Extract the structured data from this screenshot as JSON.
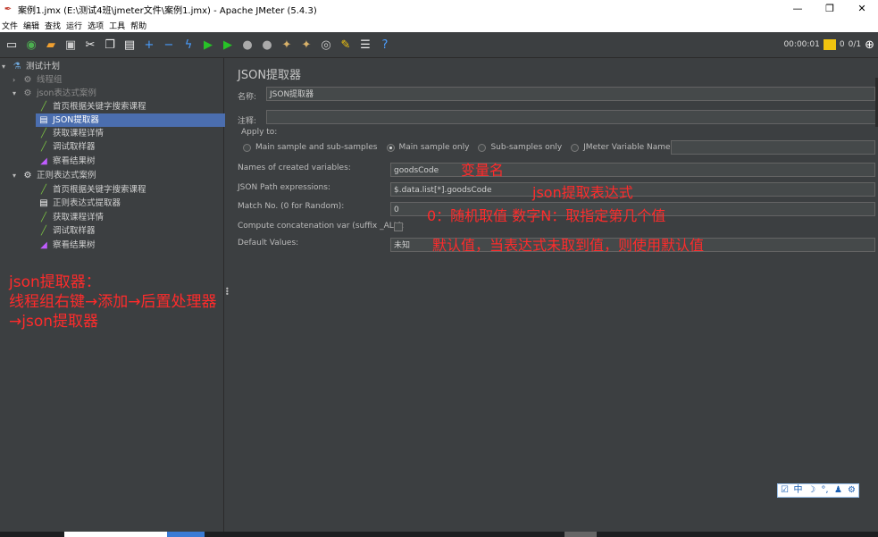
{
  "window": {
    "title": "案例1.jmx (E:\\测试4班\\jmeter文件\\案例1.jmx) - Apache JMeter (5.4.3)",
    "minimize": "—",
    "maximize": "❐",
    "close": "✕"
  },
  "menu": [
    "文件",
    "编辑",
    "查找",
    "运行",
    "选项",
    "工具",
    "帮助"
  ],
  "toolbar_status": {
    "elapsed": "00:00:01",
    "warnings": "0",
    "threads": "0/1"
  },
  "tree": [
    {
      "label": "测试计划",
      "icon": "flask-icon"
    },
    {
      "label": "线程组",
      "icon": "gear-icon"
    },
    {
      "label": "json表达式案例",
      "icon": "gear-icon"
    },
    {
      "label": "首页根据关键字搜索课程",
      "icon": "pipette-icon"
    },
    {
      "label": "JSON提取器",
      "icon": "document-icon"
    },
    {
      "label": "获取课程详情",
      "icon": "pipette-icon"
    },
    {
      "label": "调试取样器",
      "icon": "pipette-icon"
    },
    {
      "label": "察看结果树",
      "icon": "graph-icon"
    },
    {
      "label": "正则表达式案例",
      "icon": "gear-icon"
    },
    {
      "label": "首页根据关键字搜索课程",
      "icon": "pipette-icon"
    },
    {
      "label": "正则表达式提取器",
      "icon": "document-icon"
    },
    {
      "label": "获取课程详情",
      "icon": "pipette-icon"
    },
    {
      "label": "调试取样器",
      "icon": "pipette-icon"
    },
    {
      "label": "察看结果树",
      "icon": "graph-icon"
    }
  ],
  "left_annotation": {
    "line1": "json提取器：",
    "line2": "线程组右键→添加→后置处理器",
    "line3": "→json提取器"
  },
  "panel": {
    "title": "JSON提取器",
    "name_label": "名称:",
    "name_value": "JSON提取器",
    "comment_label": "注释:",
    "comment_value": "",
    "apply_to_label": "Apply to:",
    "apply_options": [
      "Main sample and sub-samples",
      "Main sample only",
      "Sub-samples only",
      "JMeter Variable Name to use"
    ],
    "apply_selected": "Main sample only",
    "var_names_label": "Names of created variables:",
    "var_names_value": "goodsCode",
    "json_path_label": "JSON Path expressions:",
    "json_path_value": "$.data.list[*].goodsCode",
    "match_no_label": "Match No. (0 for Random):",
    "match_no_value": "0",
    "concat_label": "Compute concatenation var (suffix _ALL):",
    "default_label": "Default Values:",
    "default_value": "未知"
  },
  "annotations": {
    "var_name": "变量名",
    "json_expr": "json提取表达式",
    "match_no": "0：随机取值  数字N：取指定第几个值",
    "default": "默认值，当表达式未取到值，则使用默认值"
  },
  "ime": [
    "☑",
    "中",
    "☽",
    "°,",
    "♟",
    "⚙"
  ]
}
